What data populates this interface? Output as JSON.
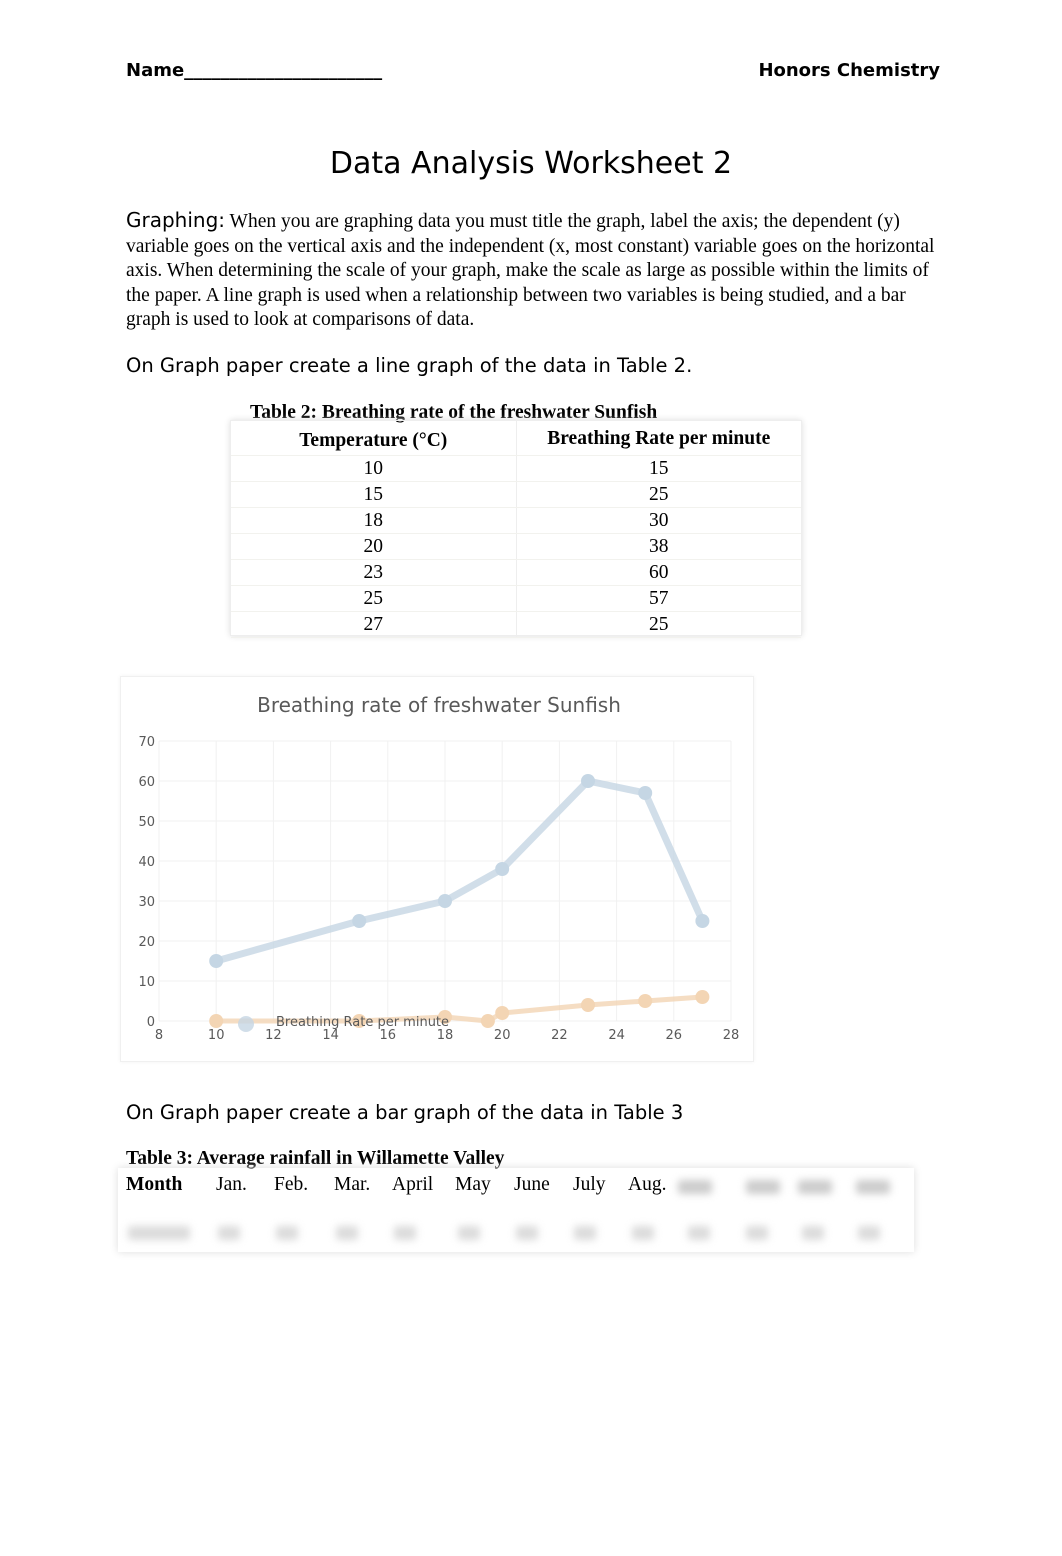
{
  "header": {
    "name_label": "Name______________________",
    "course": "Honors Chemistry"
  },
  "title": "Data Analysis Worksheet 2",
  "intro": {
    "lead": "Graphing:",
    "text": "  When you are graphing data you must title the graph, label the axis; the dependent (y) variable goes on the vertical axis and the independent (x, most constant) variable goes on the horizontal axis.  When determining the scale of your graph, make the scale as large as possible within the limits of the paper.  A line graph is used when a relationship between two variables is being studied, and a bar graph is used to look at comparisons of data."
  },
  "instruction1": "On Graph paper create a line graph of the data in Table 2.",
  "table2": {
    "caption": "Table 2:   Breathing rate of the freshwater Sunfish",
    "headers": [
      "Temperature (°C)",
      "Breathing Rate per minute"
    ],
    "rows": [
      [
        "10",
        "15"
      ],
      [
        "15",
        "25"
      ],
      [
        "18",
        "30"
      ],
      [
        "20",
        "38"
      ],
      [
        "23",
        "60"
      ],
      [
        "25",
        "57"
      ],
      [
        "27",
        "25"
      ]
    ]
  },
  "chart_data": {
    "type": "line",
    "title": "Breathing rate of freshwater Sunfish",
    "xlim": [
      8,
      28
    ],
    "ylim": [
      0,
      70
    ],
    "xticks": [
      "8",
      "10",
      "12",
      "14",
      "16",
      "18",
      "20",
      "22",
      "24",
      "26",
      "28"
    ],
    "yticks": [
      "0",
      "10",
      "20",
      "30",
      "40",
      "50",
      "60",
      "70"
    ],
    "grid": true,
    "legend": "bottom",
    "legend_label": "Breathing Rate per minute",
    "series": [
      {
        "name": "Breathing Rate per minute",
        "color": "#c5d6e4",
        "x": [
          10,
          15,
          18,
          20,
          23,
          25,
          27
        ],
        "y": [
          15,
          25,
          30,
          38,
          60,
          57,
          25
        ]
      },
      {
        "color": "#f3d5b4",
        "x": [
          10,
          15,
          18,
          19.5,
          20,
          23,
          25,
          27
        ],
        "y": [
          0,
          0,
          1,
          0,
          2,
          4,
          5,
          6
        ]
      }
    ]
  },
  "instruction2": "On Graph paper create a bar graph of the data in Table 3",
  "table3": {
    "caption": "Table 3:  Average rainfall in Willamette Valley",
    "row_header": "Month",
    "months": [
      "Jan.",
      "Feb.",
      "Mar.",
      "April",
      "May",
      "June",
      "July",
      "Aug."
    ]
  }
}
